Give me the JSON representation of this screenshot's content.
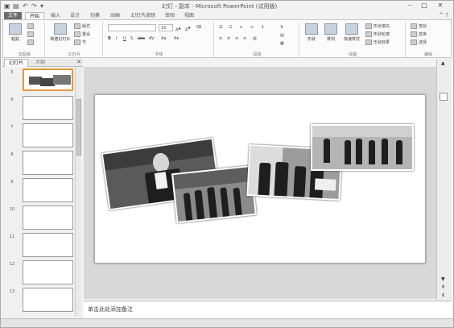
{
  "window": {
    "title": "幻灯 - 副本 - Microsoft PowerPoint (试用版)",
    "minimize": "–",
    "maximize": "□",
    "close": "✕"
  },
  "quick_access": {
    "save_icon": "save-icon",
    "undo": "↶",
    "redo": "↷"
  },
  "tabs": [
    {
      "label": "文件"
    },
    {
      "label": "开始"
    },
    {
      "label": "插入"
    },
    {
      "label": "设计"
    },
    {
      "label": "切换"
    },
    {
      "label": "动画"
    },
    {
      "label": "幻灯片放映"
    },
    {
      "label": "审阅"
    },
    {
      "label": "视图"
    }
  ],
  "ribbon": {
    "clipboard": {
      "paste": "粘贴",
      "label": "剪贴板"
    },
    "slides": {
      "new_slide": "新建幻灯片",
      "layout": "版式",
      "reset": "重设",
      "section": "节",
      "label": "幻灯片"
    },
    "font": {
      "font_size": "16",
      "label": "字体"
    },
    "paragraph": {
      "label": "段落"
    },
    "drawing": {
      "shapes": "形状",
      "arrange": "排列",
      "quick_styles": "快速样式",
      "shape_fill": "形状填充",
      "shape_outline": "形状轮廓",
      "shape_effects": "形状效果",
      "label": "绘图"
    },
    "editing": {
      "find": "查找",
      "replace": "替换",
      "select": "选择",
      "label": "编辑"
    }
  },
  "pane_tabs": [
    {
      "label": "幻灯片"
    },
    {
      "label": "大纲"
    }
  ],
  "thumbnails": [
    {
      "num": "5"
    },
    {
      "num": "6"
    },
    {
      "num": "7"
    },
    {
      "num": "8"
    },
    {
      "num": "9"
    },
    {
      "num": "10"
    },
    {
      "num": "11"
    },
    {
      "num": "12"
    },
    {
      "num": "13"
    }
  ],
  "notes": {
    "placeholder": "单击此处添加备注"
  }
}
